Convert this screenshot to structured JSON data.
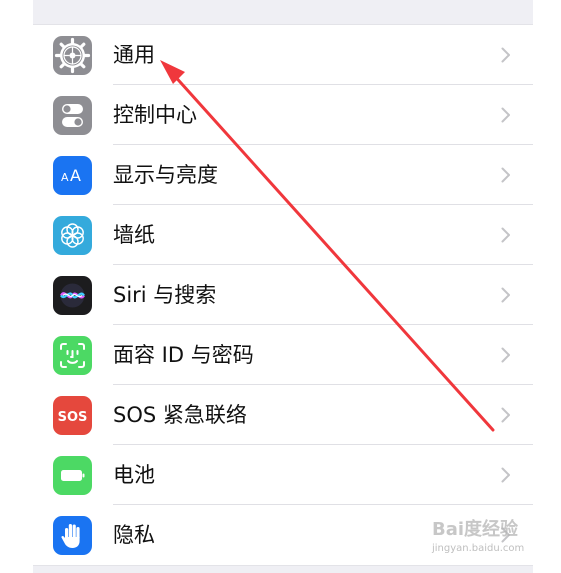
{
  "settings": {
    "items": [
      {
        "label": "通用",
        "icon": "gear-icon",
        "icon_bg": "#8e8e93"
      },
      {
        "label": "控制中心",
        "icon": "toggles-icon",
        "icon_bg": "#8e8e93"
      },
      {
        "label": "显示与亮度",
        "icon": "text-size-icon",
        "icon_bg": "#1a74f2"
      },
      {
        "label": "墙纸",
        "icon": "flower-icon",
        "icon_bg": "#34aadc"
      },
      {
        "label": "Siri 与搜索",
        "icon": "siri-icon",
        "icon_bg": "#1c1c1e"
      },
      {
        "label": "面容 ID 与密码",
        "icon": "face-id-icon",
        "icon_bg": "#4cd964"
      },
      {
        "label": "SOS 紧急联络",
        "icon": "sos-icon",
        "icon_bg": "#e5483d",
        "icon_text": "SOS"
      },
      {
        "label": "电池",
        "icon": "battery-icon",
        "icon_bg": "#4cd964"
      },
      {
        "label": "隐私",
        "icon": "hand-icon",
        "icon_bg": "#1a74f2"
      }
    ]
  },
  "annotation": {
    "arrow_color": "#f0373c",
    "points_to": "通用"
  },
  "watermark": {
    "logo": "Bai度经验",
    "url": "jingyan.baidu.com"
  }
}
